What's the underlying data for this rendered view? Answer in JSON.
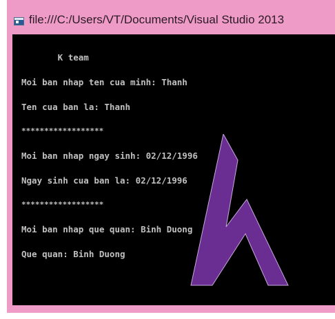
{
  "window": {
    "title": "file:///C:/Users/VT/Documents/Visual Studio 2013",
    "frame_color": "#ef9bc8",
    "icon": "console-window-icon"
  },
  "console": {
    "background": "#000000",
    "text_color": "#c0c0c0",
    "lines": [
      "       K team",
      "Moi ban nhap ten cua minh: Thanh",
      "Ten cua ban la: Thanh",
      "******************",
      "Moi ban nhap ngay sinh: 02/12/1996",
      "Ngay sinh cua ban la: 02/12/1996",
      "******************",
      "Moi ban nhap que quan: Binh Duong",
      "Que quan: Binh Duong"
    ]
  },
  "logo": {
    "icon": "purple-k-logo",
    "color": "#6a2d92",
    "edge_color": "#c8a8e0"
  }
}
